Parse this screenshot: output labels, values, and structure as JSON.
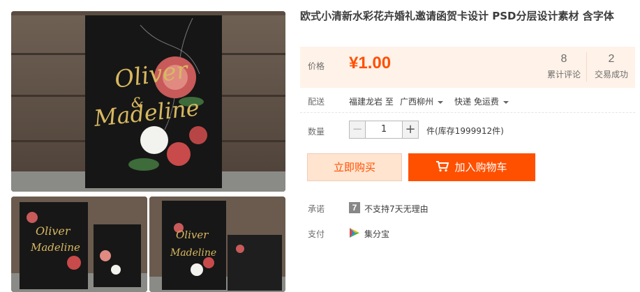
{
  "product": {
    "title": "欧式小清新水彩花卉婚礼邀请函贺卡设计 PSD分层设计素材 含字体",
    "price_label": "价格",
    "price": "¥1.00",
    "reviews_count": "8",
    "reviews_label": "累计评论",
    "sales_count": "2",
    "sales_label": "交易成功"
  },
  "shipping": {
    "label": "配送",
    "from": "福建龙岩 至",
    "to": "广西柳州",
    "method": "快递 免运费"
  },
  "quantity": {
    "label": "数量",
    "value": "1",
    "stock_text": "件(库存1999912件)"
  },
  "actions": {
    "buy_now": "立即购买",
    "add_to_cart": "加入购物车"
  },
  "promise": {
    "label": "承诺",
    "badge": "7",
    "text": "不支持7天无理由"
  },
  "payment": {
    "label": "支付",
    "text": "集分宝"
  },
  "gallery": {
    "card_names": [
      "Oliver",
      "&",
      "Madeline"
    ]
  },
  "colors": {
    "accent": "#ff5000",
    "price_bg": "#fff2e8",
    "buy_bg": "#ffe4d0"
  }
}
